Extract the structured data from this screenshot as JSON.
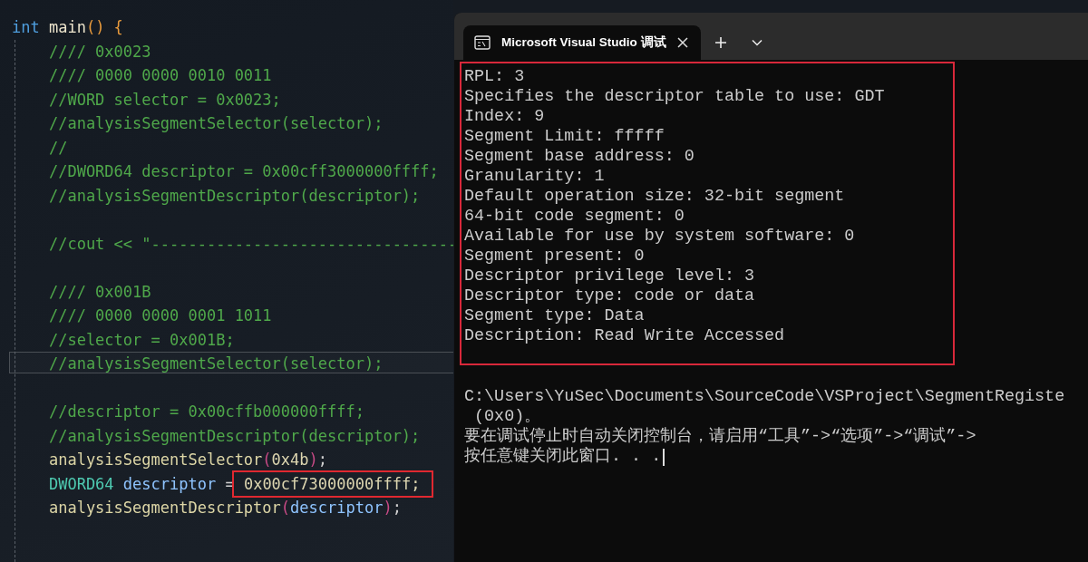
{
  "editor": {
    "lines": [
      {
        "kind": "code",
        "current": false,
        "tokens": [
          {
            "kind": "keyword",
            "text": "int "
          },
          {
            "kind": "name",
            "text": "main"
          },
          {
            "kind": "bracket",
            "text": "() {"
          }
        ]
      },
      {
        "kind": "code",
        "current": false,
        "tokens": [
          {
            "kind": "comment",
            "text": "    //// 0x0023"
          }
        ]
      },
      {
        "kind": "code",
        "current": false,
        "tokens": [
          {
            "kind": "comment",
            "text": "    //// 0000 0000 0010 0011"
          }
        ]
      },
      {
        "kind": "code",
        "current": false,
        "tokens": [
          {
            "kind": "comment",
            "text": "    //WORD selector = 0x0023;"
          }
        ]
      },
      {
        "kind": "code",
        "current": false,
        "tokens": [
          {
            "kind": "comment",
            "text": "    //analysisSegmentSelector(selector);"
          }
        ]
      },
      {
        "kind": "code",
        "current": false,
        "tokens": [
          {
            "kind": "comment",
            "text": "    //"
          }
        ]
      },
      {
        "kind": "code",
        "current": false,
        "tokens": [
          {
            "kind": "comment",
            "text": "    //DWORD64 descriptor = 0x00cff3000000ffff;"
          }
        ]
      },
      {
        "kind": "code",
        "current": false,
        "tokens": [
          {
            "kind": "comment",
            "text": "    //analysisSegmentDescriptor(descriptor);"
          }
        ]
      },
      {
        "kind": "blank"
      },
      {
        "kind": "code",
        "current": false,
        "tokens": [
          {
            "kind": "comment",
            "text": "    //cout << \"---------------------------------"
          }
        ]
      },
      {
        "kind": "blank"
      },
      {
        "kind": "code",
        "current": false,
        "tokens": [
          {
            "kind": "comment",
            "text": "    //// 0x001B"
          }
        ]
      },
      {
        "kind": "code",
        "current": false,
        "tokens": [
          {
            "kind": "comment",
            "text": "    //// 0000 0000 0001 1011"
          }
        ]
      },
      {
        "kind": "code",
        "current": false,
        "tokens": [
          {
            "kind": "comment",
            "text": "    //selector = 0x001B;"
          }
        ]
      },
      {
        "kind": "code",
        "current": true,
        "tokens": [
          {
            "kind": "comment",
            "text": "    //analysisSegmentSelector(selector);"
          }
        ]
      },
      {
        "kind": "blank"
      },
      {
        "kind": "code",
        "current": false,
        "tokens": [
          {
            "kind": "comment",
            "text": "    //descriptor = 0x00cffb000000ffff;"
          }
        ]
      },
      {
        "kind": "code",
        "current": false,
        "tokens": [
          {
            "kind": "comment",
            "text": "    //analysisSegmentDescriptor(descriptor);"
          }
        ]
      },
      {
        "kind": "code",
        "current": false,
        "tokens": [
          {
            "kind": "function",
            "text": "    analysisSegmentSelector"
          },
          {
            "kind": "bracket2",
            "text": "("
          },
          {
            "kind": "number",
            "text": "0x4b"
          },
          {
            "kind": "bracket2",
            "text": ")"
          },
          {
            "kind": "punct",
            "text": ";"
          }
        ]
      },
      {
        "kind": "code",
        "current": false,
        "tokens": [
          {
            "kind": "type",
            "text": "    DWORD64 "
          },
          {
            "kind": "variable",
            "text": "descriptor"
          },
          {
            "kind": "punct",
            "text": " = "
          },
          {
            "kind": "number",
            "text": "0x00cf73000000ffff;",
            "boxed": true
          }
        ]
      },
      {
        "kind": "code",
        "current": false,
        "tokens": [
          {
            "kind": "function",
            "text": "    analysisSegmentDescriptor"
          },
          {
            "kind": "bracket2",
            "text": "("
          },
          {
            "kind": "variable",
            "text": "descriptor"
          },
          {
            "kind": "bracket2",
            "text": ")"
          },
          {
            "kind": "punct",
            "text": ";"
          }
        ]
      }
    ]
  },
  "console": {
    "tab": {
      "title": "Microsoft Visual Studio 调试",
      "selected": true
    },
    "boxed_output": [
      "RPL: 3",
      "Specifies the descriptor table to use: GDT",
      "Index: 9",
      "Segment Limit: fffff",
      "Segment base address: 0",
      "Granularity: 1",
      "Default operation size: 32-bit segment",
      "64-bit code segment: 0",
      "Available for use by system software: 0",
      "Segment present: 0",
      "Descriptor privilege level: 3",
      "Descriptor type: code or data",
      "Segment type: Data",
      "Description: Read Write Accessed"
    ],
    "output": [
      "C:\\Users\\YuSec\\Documents\\SourceCode\\VSProject\\SegmentRegiste",
      " (0x0)。",
      "要在调试停止时自动关闭控制台，请启用“工具”->“选项”->“调试”->",
      "按任意键关闭此窗口. . ."
    ],
    "cursor": true
  }
}
